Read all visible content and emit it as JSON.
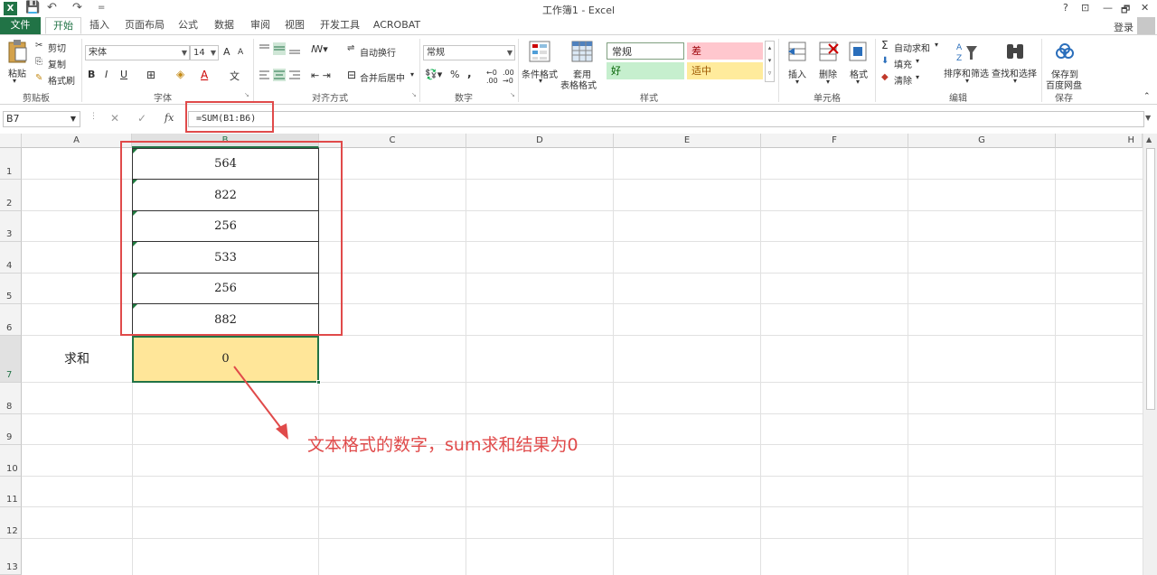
{
  "window": {
    "title": "工作簿1 - Excel",
    "help": "?",
    "restore_ribbon": "⊡",
    "minimize": "—",
    "restore": "🗗",
    "close": "✕"
  },
  "quick_access": {
    "undo": "↶",
    "redo": "↷",
    "save": "💾",
    "customize": "="
  },
  "tabs": [
    "文件",
    "开始",
    "插入",
    "页面布局",
    "公式",
    "数据",
    "审阅",
    "视图",
    "开发工具",
    "ACROBAT"
  ],
  "active_tab": "开始",
  "login": "登录",
  "ribbon": {
    "clipboard": {
      "paste": "粘贴",
      "cut": "剪切",
      "copy": "复制",
      "format_painter": "格式刷",
      "label": "剪贴板"
    },
    "font": {
      "name": "宋体",
      "size": "14",
      "bold": "B",
      "italic": "I",
      "underline": "U",
      "grow": "A",
      "shrink": "A",
      "label": "字体"
    },
    "alignment": {
      "wrap": "自动换行",
      "merge": "合并后居中",
      "label": "对齐方式"
    },
    "number": {
      "format": "常规",
      "percent": "%",
      "comma": ",",
      "label": "数字"
    },
    "styles": {
      "cond_format": "条件格式",
      "table_format_1": "套用",
      "table_format_2": "表格格式",
      "normal": "常规",
      "bad": "差",
      "good": "好",
      "neutral": "适中",
      "label": "样式"
    },
    "cells": {
      "insert": "插入",
      "delete": "删除",
      "format": "格式",
      "label": "单元格"
    },
    "editing": {
      "autosum": "自动求和",
      "fill": "填充",
      "clear": "清除",
      "sort": "排序和筛选",
      "find": "查找和选择",
      "label": "编辑"
    },
    "save": {
      "save_to_1": "保存到",
      "save_to_2": "百度网盘",
      "label": "保存"
    }
  },
  "formula_bar": {
    "name_box": "B7",
    "fx": "fx",
    "cancel": "✕",
    "enter": "✓",
    "formula": "=SUM(B1:B6)"
  },
  "columns": [
    "A",
    "B",
    "C",
    "D",
    "E",
    "F",
    "G",
    "H"
  ],
  "selected_column": "B",
  "rows": [
    "1",
    "2",
    "3",
    "4",
    "5",
    "6",
    "7",
    "8",
    "9",
    "10",
    "11",
    "12",
    "13"
  ],
  "selected_row": "7",
  "cells": {
    "B1": "564",
    "B2": "822",
    "B3": "256",
    "B4": "533",
    "B5": "256",
    "B6": "882",
    "A7": "求和",
    "B7": "0"
  },
  "annotation": "文本格式的数字，sum求和结果为0",
  "colors": {
    "excel_green": "#217346",
    "highlight_red": "#e04a4a",
    "sum_cell_fill": "#ffe699",
    "bad_fill": "#ffc7ce",
    "good_fill": "#c6efce",
    "neutral_fill": "#ffeb9c"
  }
}
